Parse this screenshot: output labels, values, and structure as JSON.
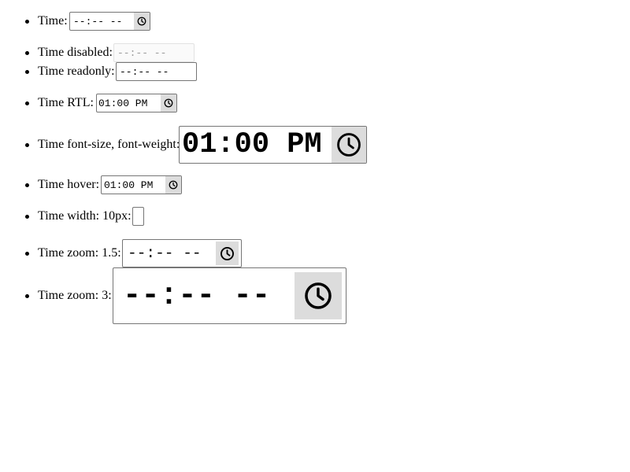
{
  "items": [
    {
      "label": "Time:",
      "value": "--:-- --",
      "icon": "clock-icon"
    },
    {
      "label": "Time disabled:",
      "value": "--:-- --"
    },
    {
      "label": "Time readonly:",
      "value": "--:-- --"
    },
    {
      "label": "Time RTL:",
      "value": "01:00 PM",
      "icon": "clock-icon"
    },
    {
      "label": "Time font-size, font-weight:",
      "value": "01:00 PM",
      "icon": "clock-icon"
    },
    {
      "label": "Time hover:",
      "value": "01:00 PM",
      "icon": "clock-icon"
    },
    {
      "label": "Time width: 10px:",
      "value": ""
    },
    {
      "label": "Time zoom: 1.5:",
      "value": "--:-- --",
      "icon": "clock-icon"
    },
    {
      "label": "Time zoom: 3:",
      "value": "--:-- --",
      "icon": "clock-icon"
    }
  ],
  "colors": {
    "picker_background": "#dcdcdc",
    "input_border": "#767676",
    "disabled_text": "#9a9a9a"
  }
}
